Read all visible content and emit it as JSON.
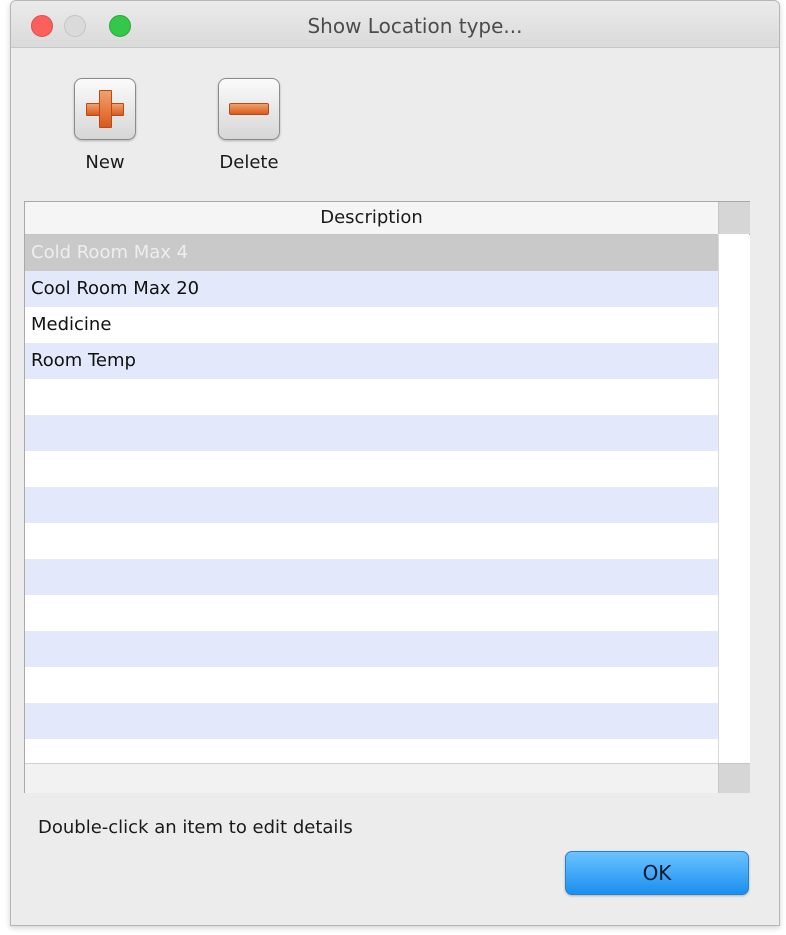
{
  "window": {
    "title": "Show Location type..."
  },
  "toolbar": {
    "new_label": "New",
    "delete_label": "Delete"
  },
  "table": {
    "column_header": "Description",
    "rows": [
      {
        "description": "Cold Room Max 4",
        "selected": true
      },
      {
        "description": "Cool Room Max 20",
        "selected": false
      },
      {
        "description": "Medicine",
        "selected": false
      },
      {
        "description": "Room Temp",
        "selected": false
      }
    ]
  },
  "footer": {
    "hint": "Double-click an item to edit details",
    "ok_label": "OK"
  },
  "colors": {
    "accent_button": "#1a8fef",
    "row_alt": "#e3e8fb",
    "row_selected": "#c9c9c9",
    "close": "#fc605c",
    "zoom": "#34c84a"
  },
  "icons": [
    "plus-icon",
    "minus-icon"
  ]
}
